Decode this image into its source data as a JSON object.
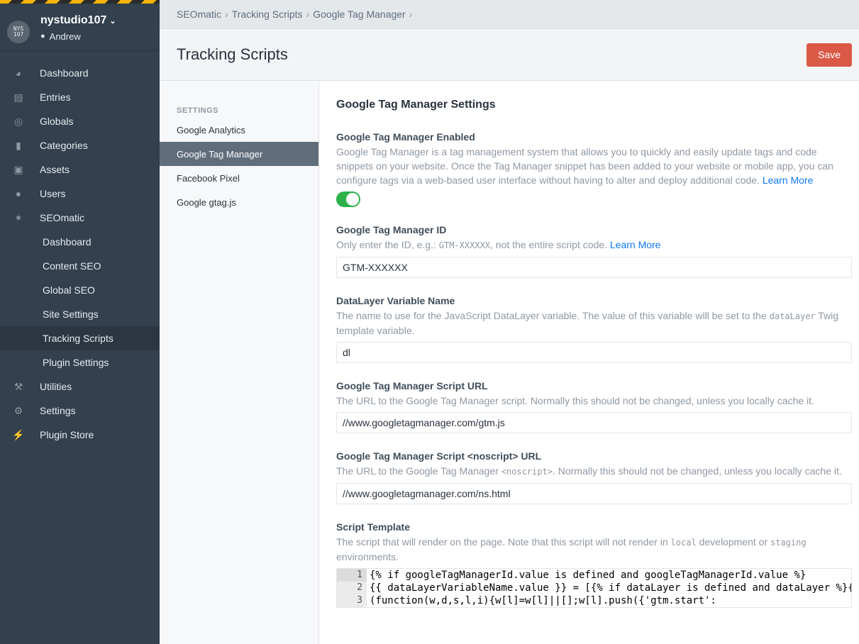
{
  "sidebar": {
    "logo_text": "NYS 107",
    "site_name": "nystudio107",
    "user_name": "Andrew",
    "nav": [
      {
        "label": "Dashboard",
        "icon": "dashboard-icon"
      },
      {
        "label": "Entries",
        "icon": "entries-icon"
      },
      {
        "label": "Globals",
        "icon": "globe-icon"
      },
      {
        "label": "Categories",
        "icon": "folder-icon"
      },
      {
        "label": "Assets",
        "icon": "image-icon"
      },
      {
        "label": "Users",
        "icon": "users-icon"
      },
      {
        "label": "SEOmatic",
        "icon": "seomatic-icon"
      }
    ],
    "seomatic_sub": [
      {
        "label": "Dashboard"
      },
      {
        "label": "Content SEO"
      },
      {
        "label": "Global SEO"
      },
      {
        "label": "Site Settings"
      },
      {
        "label": "Tracking Scripts"
      },
      {
        "label": "Plugin Settings"
      }
    ],
    "nav_bottom": [
      {
        "label": "Utilities",
        "icon": "wrench-icon"
      },
      {
        "label": "Settings",
        "icon": "gear-icon"
      },
      {
        "label": "Plugin Store",
        "icon": "plug-icon"
      }
    ]
  },
  "breadcrumbs": [
    "SEOmatic",
    "Tracking Scripts",
    "Google Tag Manager"
  ],
  "header": {
    "title": "Tracking Scripts",
    "save_label": "Save"
  },
  "subnav": {
    "heading": "SETTINGS",
    "items": [
      "Google Analytics",
      "Google Tag Manager",
      "Facebook Pixel",
      "Google gtag.js"
    ]
  },
  "main": {
    "section_title": "Google Tag Manager Settings",
    "enabled": {
      "label": "Google Tag Manager Enabled",
      "instructions": "Google Tag Manager is a tag management system that allows you to quickly and easily update tags and code snippets on your website. Once the Tag Manager snippet has been added to your website or mobile app, you can configure tags via a web-based user interface without having to alter and deploy additional code.",
      "link": "Learn More",
      "value": true
    },
    "gtm_id": {
      "label": "Google Tag Manager ID",
      "instr_before": "Only enter the ID, e.g.: ",
      "instr_code": "GTM-XXXXXX",
      "instr_after": ", not the entire script code.",
      "link": "Learn More",
      "value": "GTM-XXXXXX"
    },
    "datalayer": {
      "label": "DataLayer Variable Name",
      "instr_before": "The name to use for the JavaScript DataLayer variable. The value of this variable will be set to the ",
      "instr_code": "dataLayer",
      "instr_after": " Twig template variable.",
      "value": "dl"
    },
    "script_url": {
      "label": "Google Tag Manager Script URL",
      "instructions": "The URL to the Google Tag Manager script. Normally this should not be changed, unless you locally cache it.",
      "value": "//www.googletagmanager.com/gtm.js"
    },
    "noscript_url": {
      "label": "Google Tag Manager Script <noscript> URL",
      "instr_before": "The URL to the Google Tag Manager ",
      "instr_code": "<noscript>",
      "instr_after": ". Normally this should not be changed, unless you locally cache it.",
      "value": "//www.googletagmanager.com/ns.html"
    },
    "script_template": {
      "label": "Script Template",
      "instr_before": "The script that will render on the page. Note that this script will not render in ",
      "instr_code1": "local",
      "instr_middle": " development or ",
      "instr_code2": "staging",
      "instr_after": " environments.",
      "lines": [
        {
          "num": "1",
          "text": "{% if googleTagManagerId.value is defined and googleTagManagerId.value %}"
        },
        {
          "num": "2",
          "text": "{{ dataLayerVariableName.value }} = [{% if dataLayer is defined and dataLayer %}{"
        },
        {
          "num": "3",
          "text": "(function(w,d,s,l,i){w[l]=w[l]||[];w[l].push({'gtm.start':"
        }
      ]
    }
  }
}
